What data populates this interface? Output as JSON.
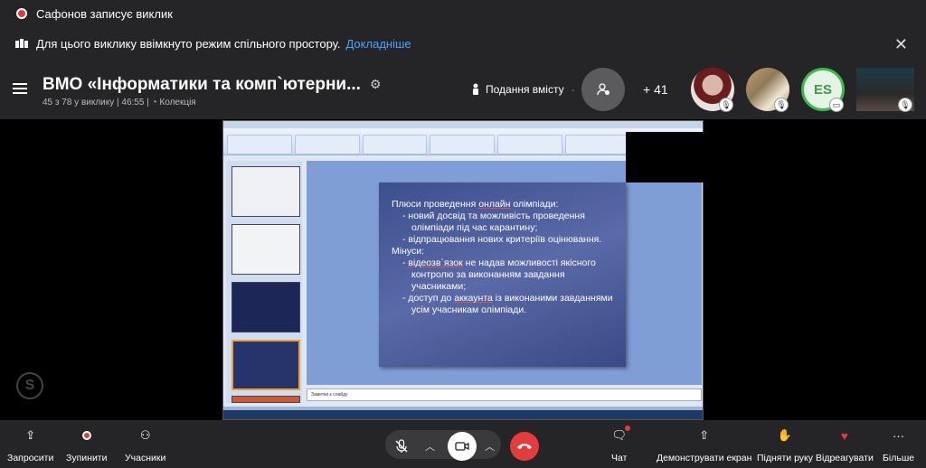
{
  "recording": {
    "text": "Сафонов записує виклик"
  },
  "notice": {
    "text": "Для цього виклику ввімкнуто режим спільного простору.",
    "link": "Докладніше"
  },
  "header": {
    "title": "ВМО «Інформатики та комп`ютерни...",
    "subtitle": "45 з 78 у виклику | 46:55 | ",
    "collection": "Колекція",
    "presenting": "Подання вмісту",
    "dash": "-",
    "participant_count": "+ 41",
    "avatar_initials": "ES"
  },
  "slide": {
    "heading_pre": "Плюси проведення ",
    "heading_link": "онлайн",
    "heading_post": " олімпіади:",
    "bullet1": "- новий досвід та можливість проведення олімпіади під час карантину;",
    "bullet2": "- відпрацювання нових критеріїв оцінювання.",
    "minuses": "Мінуси:",
    "bullet3_link": "відеозв`язок",
    "bullet3_rest": " не надав можливості якісного контролю за виконанням завдання учасниками;",
    "bullet4_pre": "- доступ до ",
    "bullet4_link": "аккаунта",
    "bullet4_rest": " із виконаними завданнями усім учасникам олімпіади.",
    "notes": "Заметки к слайду"
  },
  "toolbar": {
    "invite": "Запросити",
    "stop": "Зупинити",
    "participants": "Учасники",
    "chat": "Чат",
    "share_screen": "Демонструвати екран",
    "raise_hand": "Підняти руку",
    "react": "Відреагувати",
    "more": "Більше"
  },
  "colors": {
    "accent_link": "#4aa3ff",
    "end_call": "#e23c3c",
    "bar_bg": "#252527"
  }
}
